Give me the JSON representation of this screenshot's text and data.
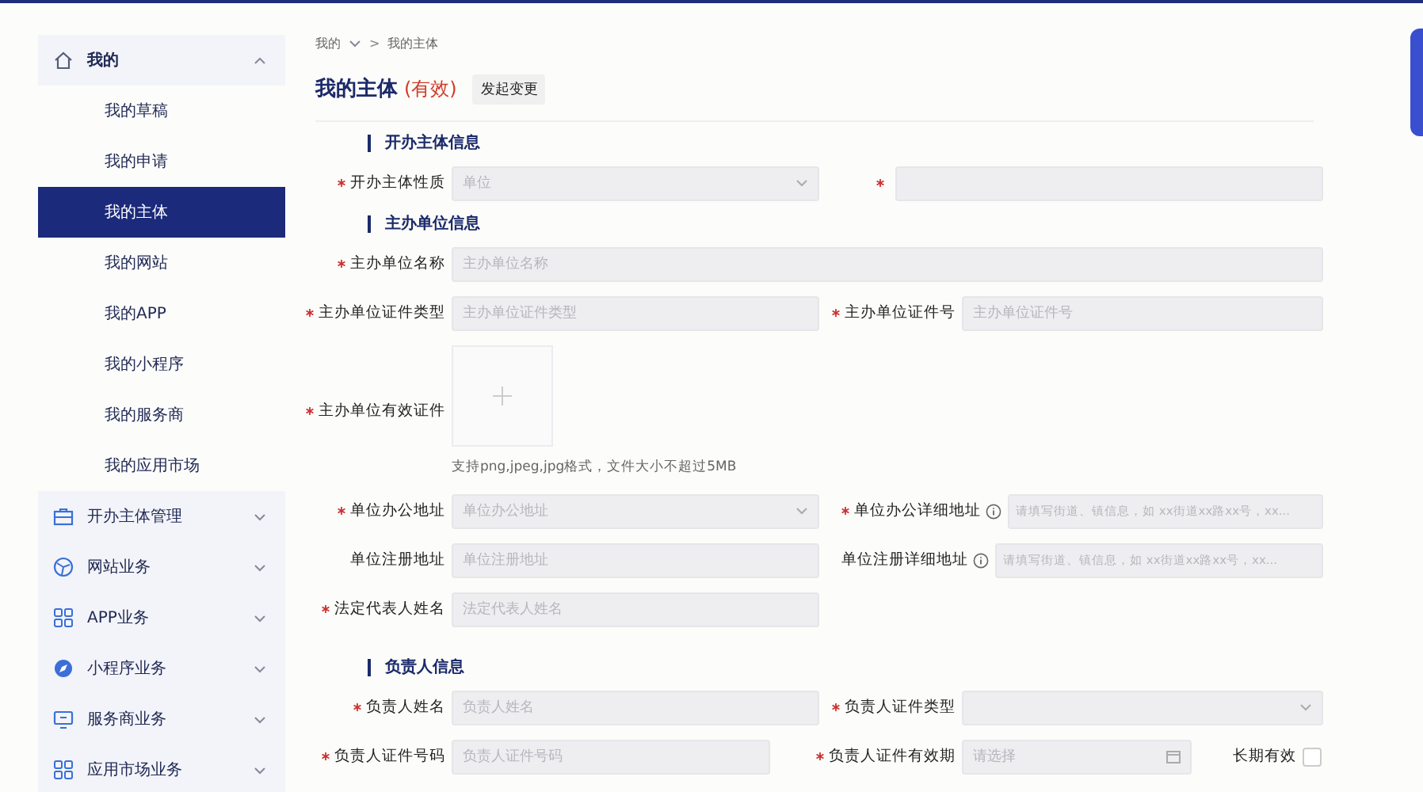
{
  "breadcrumb": {
    "items": [
      "我的",
      "我的主体"
    ],
    "separator": ">"
  },
  "sidebar": {
    "items": [
      {
        "label": "我的",
        "expanded": true,
        "children": [
          {
            "label": "我的草稿",
            "selected": false
          },
          {
            "label": "我的申请",
            "selected": false
          },
          {
            "label": "我的主体",
            "selected": true
          },
          {
            "label": "我的网站",
            "selected": false
          },
          {
            "label": "我的APP",
            "selected": false
          },
          {
            "label": "我的小程序",
            "selected": false
          },
          {
            "label": "我的服务商",
            "selected": false
          },
          {
            "label": "我的应用市场",
            "selected": false
          }
        ]
      },
      {
        "label": "开办主体管理",
        "expanded": false
      },
      {
        "label": "网站业务",
        "expanded": false
      },
      {
        "label": "APP业务",
        "expanded": false
      },
      {
        "label": "小程序业务",
        "expanded": false
      },
      {
        "label": "服务商业务",
        "expanded": false
      },
      {
        "label": "应用市场业务",
        "expanded": false
      }
    ]
  },
  "page": {
    "title": "我的主体",
    "status": "(有效)",
    "action": "发起变更"
  },
  "sections": [
    {
      "title": "开办主体信息",
      "rows": [
        [
          {
            "label": "开办主体性质",
            "required": true,
            "kind": "select",
            "placeholder": "单位"
          },
          {
            "required": true,
            "kind": "input"
          }
        ]
      ]
    },
    {
      "title": "主办单位信息",
      "rows": [
        [
          {
            "label": "主办单位名称",
            "required": true,
            "kind": "input",
            "placeholder": "主办单位名称",
            "full": true
          }
        ],
        [
          {
            "label": "主办单位证件类型",
            "required": true,
            "kind": "input",
            "placeholder": "主办单位证件类型"
          },
          {
            "label": "主办单位证件号",
            "required": true,
            "kind": "input",
            "placeholder": "主办单位证件号"
          }
        ],
        [
          {
            "label": "主办单位有效证件",
            "required": true,
            "kind": "upload",
            "hint": "支持png,jpeg,jpg格式，文件大小不超过5MB"
          }
        ],
        [
          {
            "label": "单位办公地址",
            "required": true,
            "kind": "select",
            "placeholder": "单位办公地址"
          },
          {
            "label": "单位办公详细地址",
            "required": true,
            "info": true,
            "kind": "input",
            "placeholder": "请填写街道、镇信息，如 xx街道xx路xx号，xx..."
          }
        ],
        [
          {
            "label": "单位注册地址",
            "required": false,
            "kind": "input",
            "placeholder": "单位注册地址"
          },
          {
            "label": "单位注册详细地址",
            "required": false,
            "info": true,
            "kind": "input",
            "placeholder": "请填写街道、镇信息，如 xx街道xx路xx号，xx..."
          }
        ],
        [
          {
            "label": "法定代表人姓名",
            "required": true,
            "kind": "input",
            "placeholder": "法定代表人姓名"
          }
        ]
      ]
    },
    {
      "title": "负责人信息",
      "rows": [
        [
          {
            "label": "负责人姓名",
            "required": true,
            "kind": "input",
            "placeholder": "负责人姓名"
          },
          {
            "label": "负责人证件类型",
            "required": true,
            "kind": "select"
          }
        ],
        [
          {
            "label": "负责人证件号码",
            "required": true,
            "kind": "input",
            "placeholder": "负责人证件号码"
          },
          {
            "label": "负责人证件有效期",
            "required": true,
            "kind": "date",
            "placeholder": "请选择"
          },
          {
            "label": "长期有效",
            "kind": "checkbox",
            "checked": false
          }
        ]
      ]
    }
  ]
}
